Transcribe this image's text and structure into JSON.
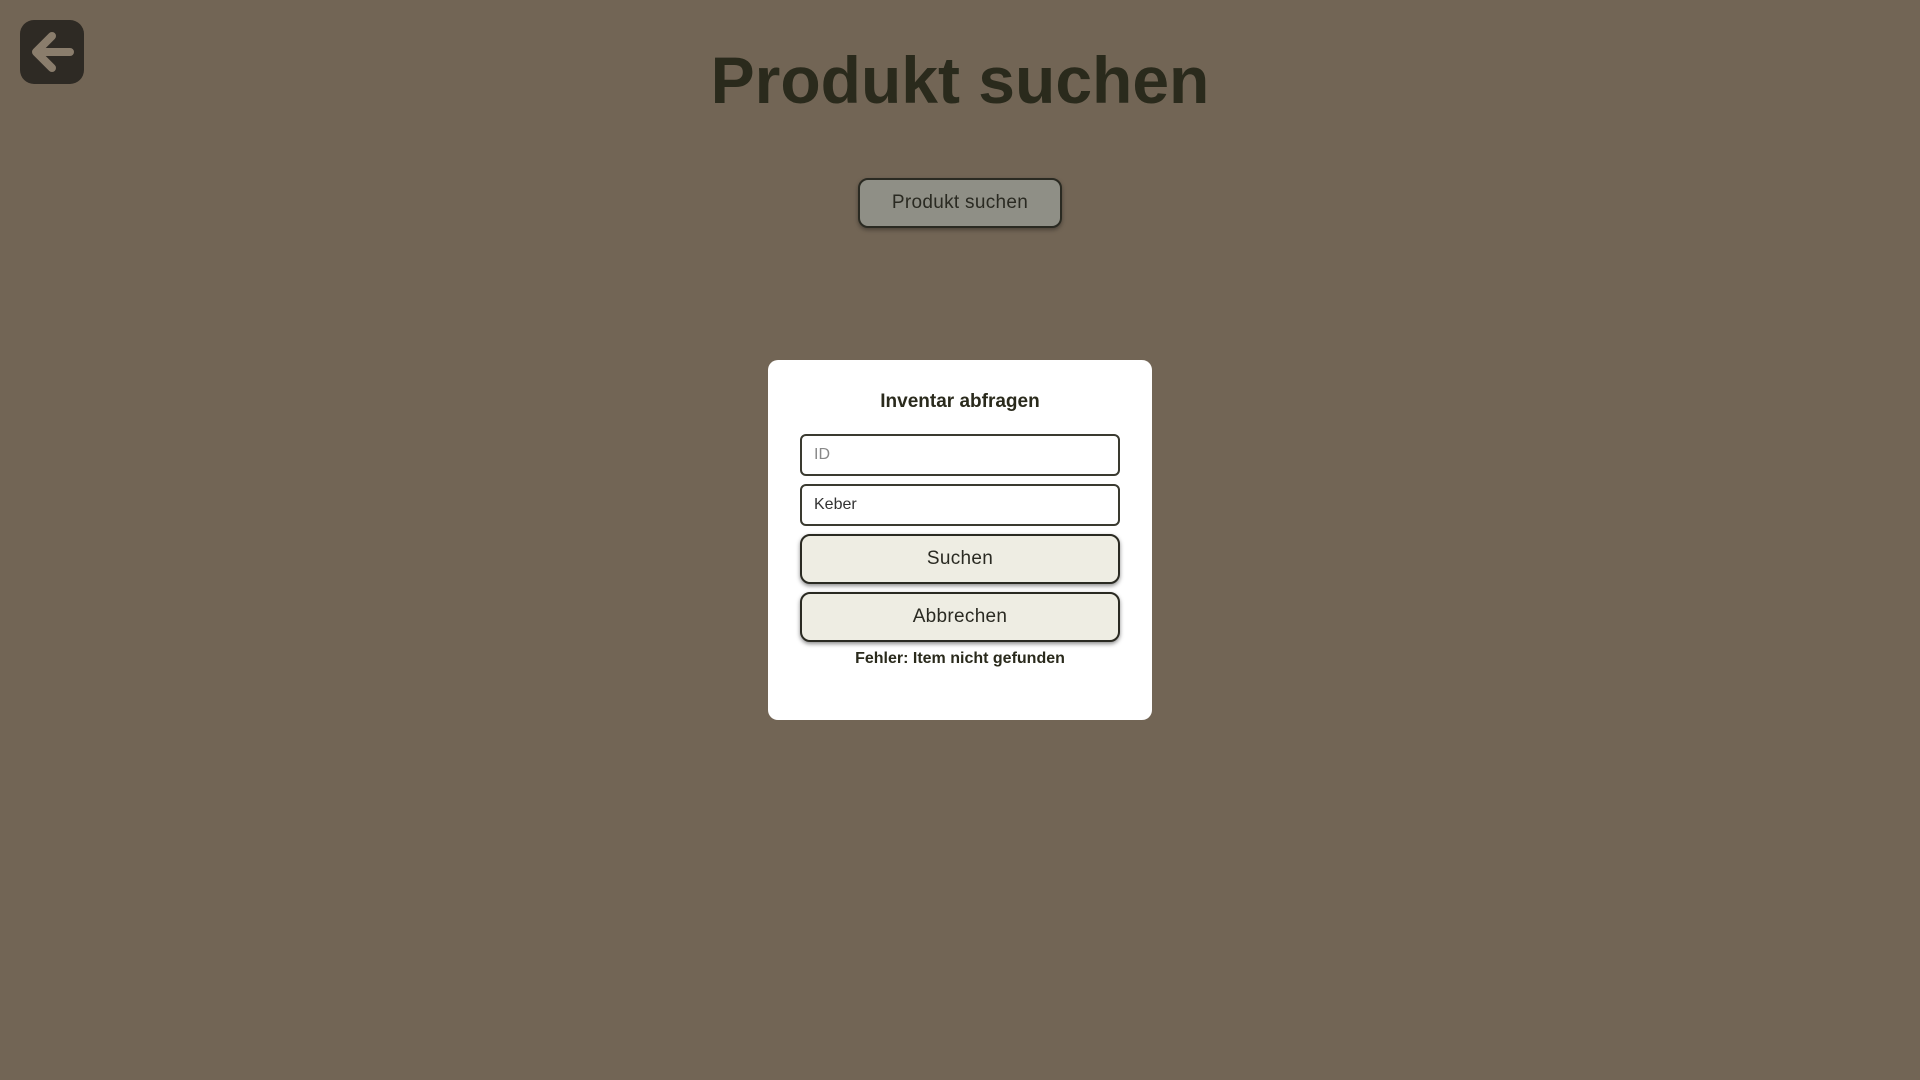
{
  "page": {
    "title": "Produkt suchen",
    "search_button_label": "Produkt suchen",
    "back_icon": "arrow-left-icon"
  },
  "dialog": {
    "title": "Inventar abfragen",
    "id_field": {
      "placeholder": "ID",
      "value": ""
    },
    "name_field": {
      "placeholder": "",
      "value": "Keber"
    },
    "search_label": "Suchen",
    "cancel_label": "Abbrechen",
    "error_message": "Fehler: Item nicht gefunden"
  },
  "colors": {
    "background": "#726555",
    "back_button": "#2e2a24",
    "title_text": "#2a2a1c",
    "top_button_bg": "#8f8f86",
    "dialog_bg": "#ffffff",
    "dialog_button_bg": "#eeede3"
  }
}
